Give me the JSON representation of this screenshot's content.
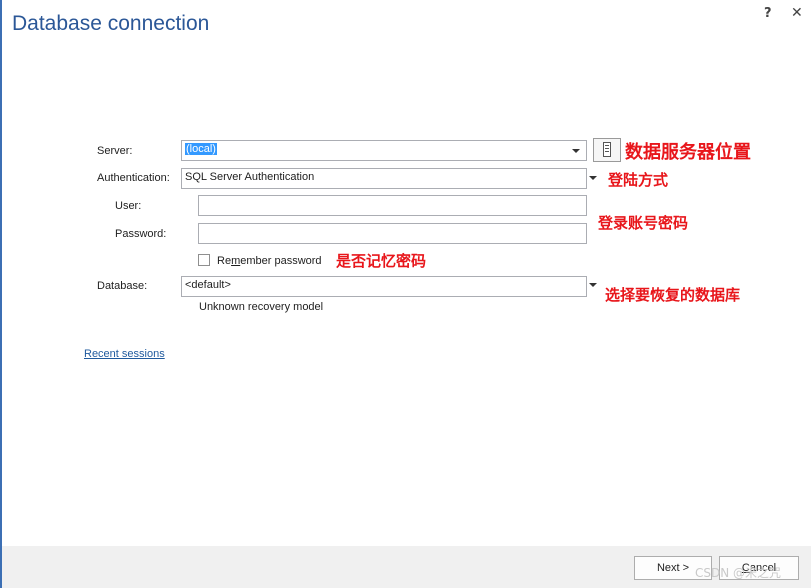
{
  "dialog": {
    "title": "Database connection",
    "help_label": "?",
    "close_label": "✕"
  },
  "form": {
    "server": {
      "label": "Server:",
      "value": "(local)"
    },
    "authentication": {
      "label": "Authentication:",
      "value": "SQL Server Authentication"
    },
    "user": {
      "label": "User:",
      "value": ""
    },
    "password": {
      "label": "Password:",
      "value": ""
    },
    "remember": {
      "label_pre": "Re",
      "label_key": "m",
      "label_post": "ember password",
      "checked": false
    },
    "database": {
      "label": "Database:",
      "value": "<default>"
    },
    "recovery_note": "Unknown recovery model"
  },
  "annotations": {
    "server": "数据服务器位置",
    "auth": "登陆方式",
    "account": "登录账号密码",
    "remember": "是否记忆密码",
    "database": "选择要恢复的数据库"
  },
  "recent_sessions_label": "Recent sessions",
  "buttons": {
    "next": "Next >",
    "cancel_key": "C",
    "cancel_rest": "ancel"
  },
  "watermark": "CSDN @米之咒",
  "colors": {
    "title": "#2b5797",
    "annotation": "#e8161b",
    "selection": "#3399ff",
    "link": "#1f5a9e"
  }
}
